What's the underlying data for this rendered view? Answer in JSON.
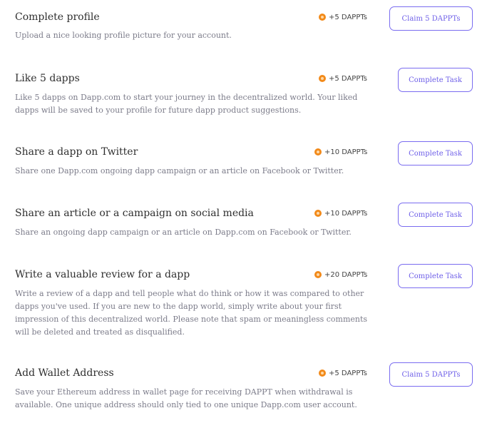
{
  "tasks": [
    {
      "title": "Complete profile",
      "description": "Upload a nice looking profile picture for your account.",
      "reward": "+5 DAPPTs",
      "button": "Claim 5 DAPPTs",
      "coin_icon": "coin-icon"
    },
    {
      "title": "Like 5 dapps",
      "description": "Like 5 dapps on Dapp.com to start your journey in the decentralized world. Your liked dapps will be saved to your profile for future dapp product suggestions.",
      "reward": "+5 DAPPTs",
      "button": "Complete Task",
      "coin_icon": "coin-icon"
    },
    {
      "title": "Share a dapp on Twitter",
      "description": "Share one Dapp.com ongoing dapp campaign or an article on Facebook or Twitter.",
      "reward": "+10 DAPPTs",
      "button": "Complete Task",
      "coin_icon": "coin-icon"
    },
    {
      "title": "Share an article or a campaign on social media",
      "description": "Share an ongoing dapp campaign or an article on Dapp.com on Facebook or Twitter.",
      "reward": "+10 DAPPTs",
      "button": "Complete Task",
      "coin_icon": "coin-icon"
    },
    {
      "title": "Write a valuable review for a dapp",
      "description": "Write a review of a dapp and tell people what do think or how it was compared to other dapps you've used. If you are new to the dapp world, simply write about your first impression of this decentralized world. Please note that spam or meaningless comments will be deleted and treated as disqualified.",
      "reward": "+20 DAPPTs",
      "button": "Complete Task",
      "coin_icon": "coin-icon"
    },
    {
      "title": "Add Wallet Address",
      "description": "Save your Ethereum address in wallet page for receiving DAPPT when withdrawal is available. One unique address should only tied to one unique Dapp.com user account.",
      "reward": "+5 DAPPTs",
      "button": "Claim 5 DAPPTs",
      "coin_icon": "coin-icon"
    }
  ],
  "colors": {
    "accent": "#6e5fe8",
    "coin": "#f28a1a",
    "title_text": "#2f2f2f",
    "description_text": "#7c7c8a"
  }
}
